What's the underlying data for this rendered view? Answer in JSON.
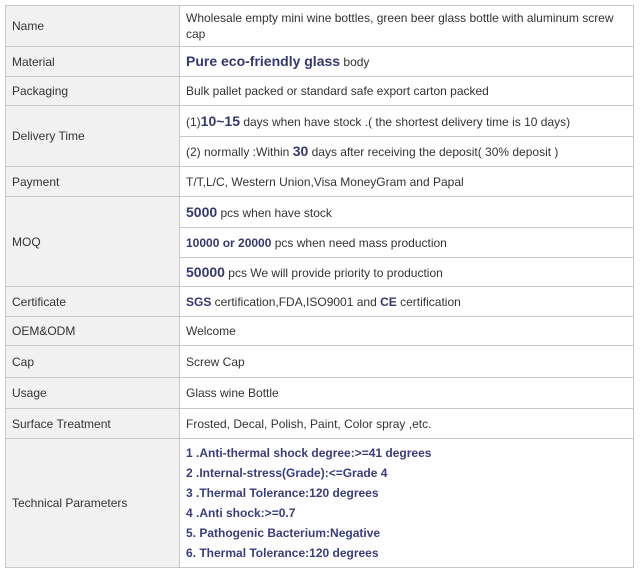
{
  "rows": {
    "name": {
      "label": "Name",
      "value": "Wholesale empty mini wine bottles, green beer glass bottle with aluminum screw cap"
    },
    "material": {
      "label": "Material",
      "highlight": "Pure eco-friendly glass",
      "rest": " body"
    },
    "packaging": {
      "label": "Packaging",
      "value": "Bulk pallet packed or standard safe export carton packed"
    },
    "delivery": {
      "label": "Delivery Time",
      "line1_prefix": "(1)",
      "line1_highlight": "10~15",
      "line1_rest": " days when have stock .( the shortest delivery time is 10 days)",
      "line2_prefix": "(2) normally :Within ",
      "line2_highlight": "30",
      "line2_rest": " days after receiving the deposit( 30% deposit )"
    },
    "payment": {
      "label": "Payment",
      "value": "T/T,L/C, Western Union,Visa  MoneyGram and Papal"
    },
    "moq": {
      "label": "MOQ",
      "line1_highlight": "5000",
      "line1_rest": " pcs when have stock",
      "line2_highlight": "10000 or 20000",
      "line2_rest": " pcs when need mass production",
      "line3_highlight": "50000",
      "line3_rest": " pcs We will provide priority to production"
    },
    "certificate": {
      "label": "Certificate",
      "h1": "SGS",
      "mid": " certification,FDA,ISO9001 and ",
      "h2": "CE",
      "rest": " certification"
    },
    "oem": {
      "label": "OEM&ODM",
      "value": "Welcome"
    },
    "cap": {
      "label": "Cap",
      "value": "Screw Cap"
    },
    "usage": {
      "label": "Usage",
      "value": "Glass wine Bottle"
    },
    "surface": {
      "label": "Surface Treatment",
      "value": "Frosted, Decal, Polish, Paint, Color spray ,etc."
    },
    "technical": {
      "label": "Technical Parameters",
      "items": [
        "1 .Anti-thermal shock degree:>=41 degrees",
        "2 .Internal-stress(Grade):<=Grade 4",
        "3 .Thermal Tolerance:120 degrees",
        "4 .Anti shock:>=0.7",
        "5. Pathogenic Bacterium:Negative",
        "6. Thermal Tolerance:120 degrees"
      ]
    }
  },
  "colors": {
    "label_bg": "#f1f1f1",
    "border": "#c8c8c8",
    "highlight": "#35386e",
    "text": "#333333"
  }
}
